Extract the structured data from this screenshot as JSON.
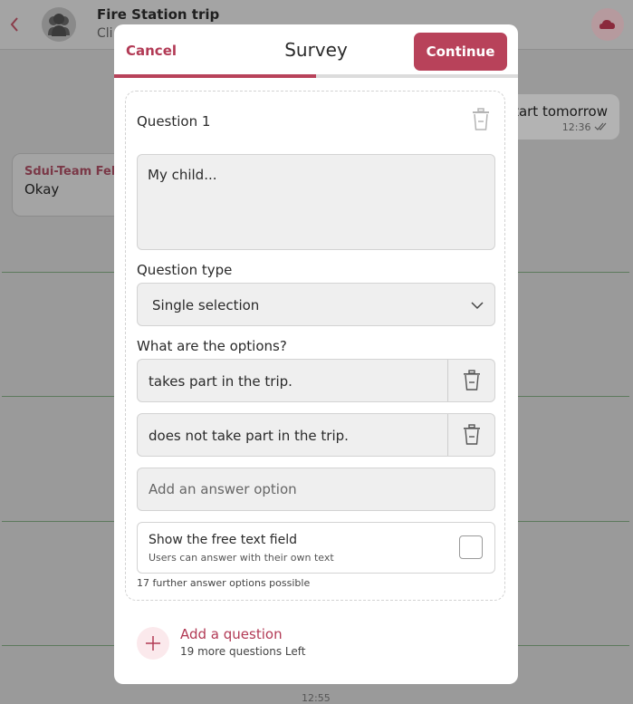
{
  "chat": {
    "title": "Fire Station trip",
    "subtitle": "Cli",
    "outgoing_text": "tart tomorrow",
    "outgoing_time": "12:36",
    "incoming_sender": "Sdui-Team Felix",
    "incoming_text": "Okay",
    "bottom_time": "12:55"
  },
  "modal": {
    "cancel_label": "Cancel",
    "title": "Survey",
    "continue_label": "Continue",
    "progress_fraction": 0.5
  },
  "question": {
    "label": "Question 1",
    "text": "My child...",
    "type_label": "Question type",
    "type_value": "Single selection",
    "options_label": "What are the options?",
    "options": [
      {
        "text": "takes part in the trip."
      },
      {
        "text": "does not take part in the trip."
      }
    ],
    "add_option_placeholder": "Add an answer option",
    "free_text_title": "Show the free text field",
    "free_text_subtitle": "Users can answer with their own text",
    "free_text_checked": false,
    "further_options_note": "17 further answer options possible"
  },
  "add_question": {
    "label": "Add a question",
    "remaining": "19 more questions Left"
  },
  "colors": {
    "accent": "#b8425a",
    "accent_text": "#b23a55",
    "overlay": "#9a9a9a"
  }
}
